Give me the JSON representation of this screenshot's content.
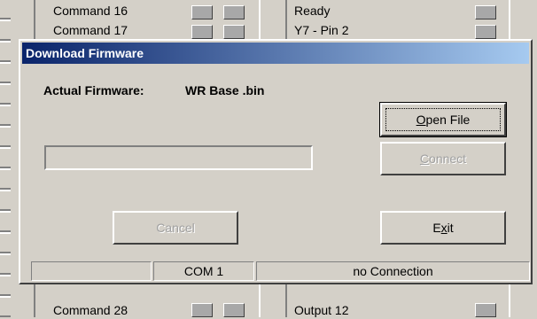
{
  "background": {
    "left_items": [
      "Command 16",
      "Command 17",
      "Command 28"
    ],
    "right_items": [
      "Ready",
      "Y7 - Pin 2",
      "Output 12"
    ]
  },
  "dialog": {
    "title": "Download Firmware",
    "firmware_label": "Actual Firmware:",
    "firmware_value": "WR Base .bin",
    "progress_percent": 0,
    "buttons": {
      "open_file": {
        "pre": "",
        "accel": "O",
        "post": "pen File",
        "enabled": true
      },
      "connect": {
        "pre": "",
        "accel": "C",
        "post": "onnect",
        "enabled": false
      },
      "cancel": {
        "label": "Cancel",
        "enabled": false
      },
      "exit": {
        "pre": "E",
        "accel": "x",
        "post": "it",
        "enabled": true
      }
    }
  },
  "statusbar": {
    "cell1": "",
    "port": "COM 1",
    "connection": "no Connection"
  }
}
